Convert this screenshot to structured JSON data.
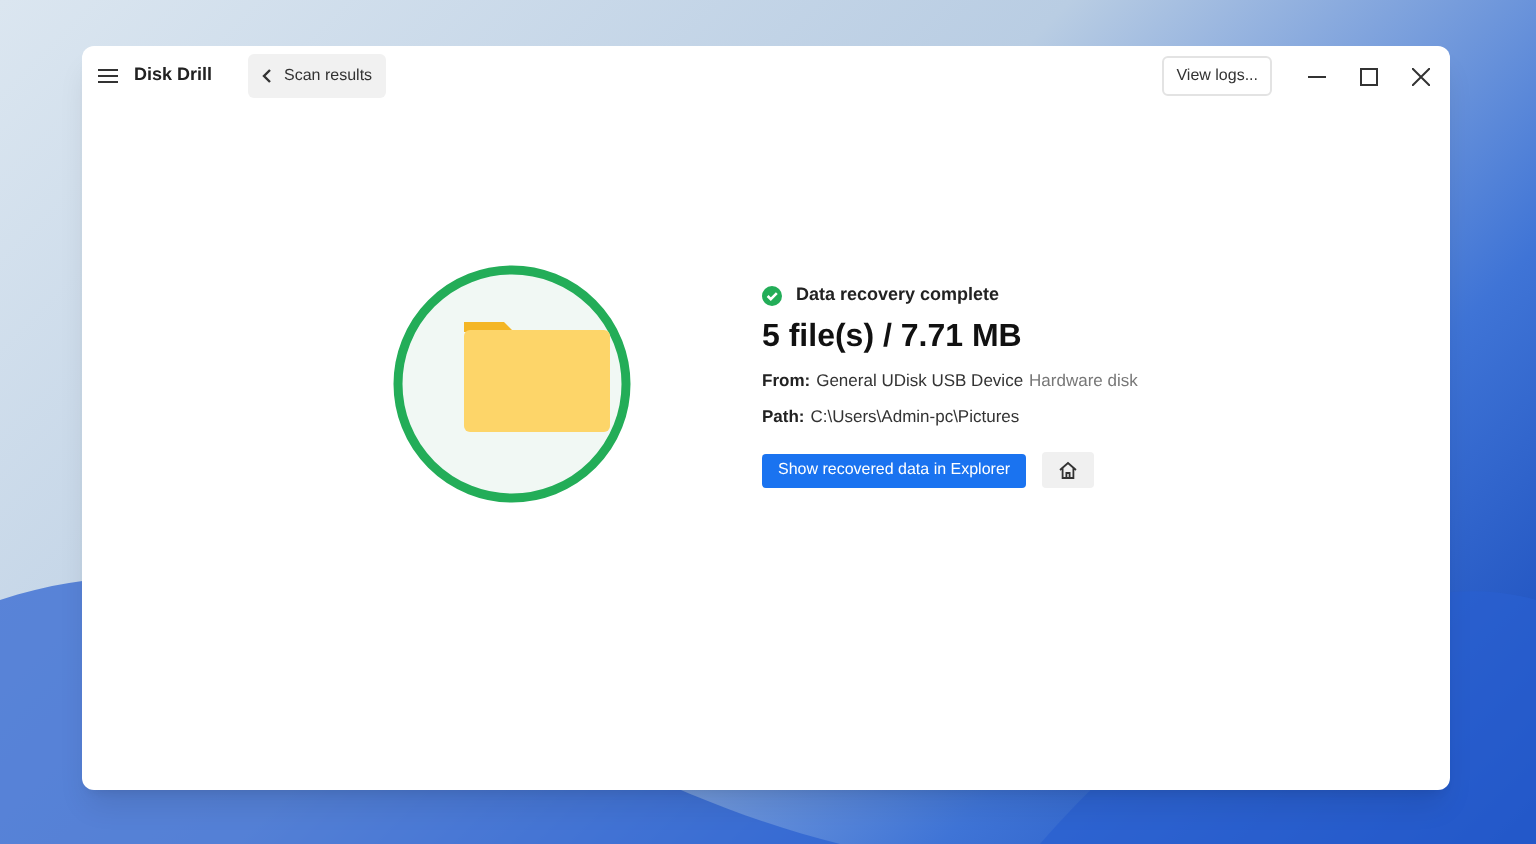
{
  "window": {
    "title": "Disk Drill",
    "back_button": "Scan results",
    "view_logs_button": "View logs..."
  },
  "result": {
    "status": "Data recovery complete",
    "complete": true,
    "summary": "5 file(s) / 7.71 MB",
    "from": {
      "label": "From:",
      "value": "General UDisk USB Device",
      "type": "Hardware disk"
    },
    "path": {
      "label": "Path:",
      "value": "C:\\Users\\Admin-pc\\Pictures"
    },
    "primary_button": "Show recovered data in Explorer"
  }
}
